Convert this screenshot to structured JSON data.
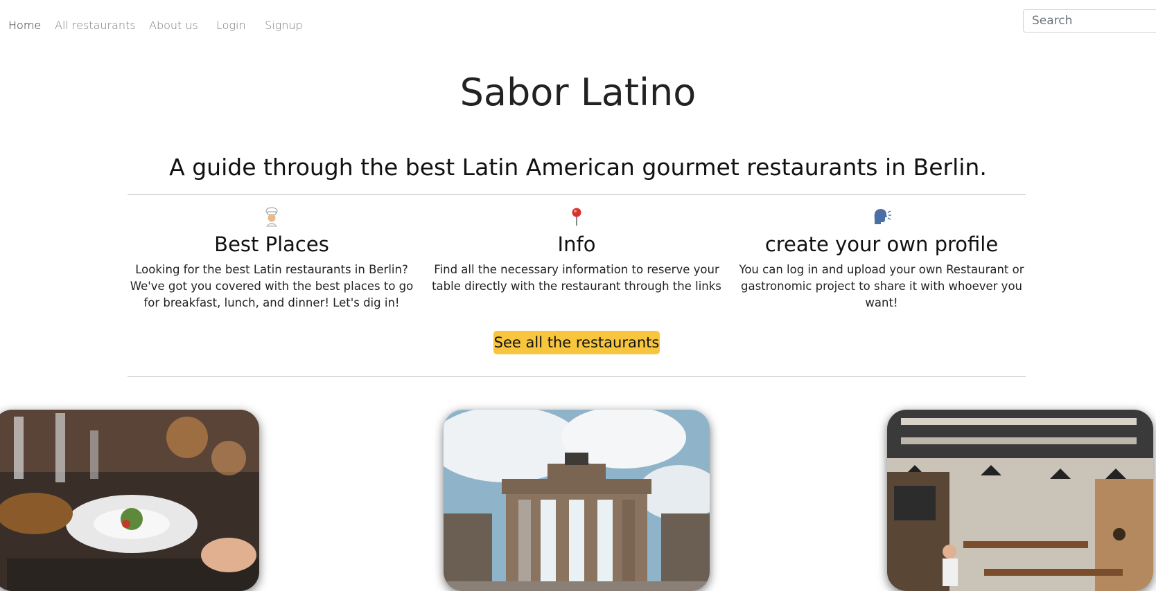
{
  "nav": {
    "links": [
      "Home",
      "All restaurants",
      "About us",
      "Login",
      "Signup"
    ],
    "search_placeholder": "Search"
  },
  "hero": {
    "title": "Sabor Latino",
    "subtitle": "A guide through the best Latin American gourmet restaurants in Berlin."
  },
  "features": [
    {
      "icon": "chef-icon",
      "title": "Best Places",
      "text": "Looking for the best Latin restaurants in Berlin? We've got you covered with the best places to go for breakfast, lunch, and dinner! Let's dig in!"
    },
    {
      "icon": "map-pin-icon",
      "title": "Info",
      "text": "Find all the necessary information to reserve your table directly with the restaurant through the links"
    },
    {
      "icon": "speaking-head-icon",
      "title": "create your own profile",
      "text": "You can log in and upload your own Restaurant or gastronomic project to share it with whoever you want!"
    }
  ],
  "cta": {
    "label": "See all the restaurants"
  },
  "gallery": [
    "dining-table-photo",
    "brandenburg-gate-photo",
    "restaurant-interior-photo"
  ],
  "colors": {
    "accent": "#f8c63c"
  }
}
